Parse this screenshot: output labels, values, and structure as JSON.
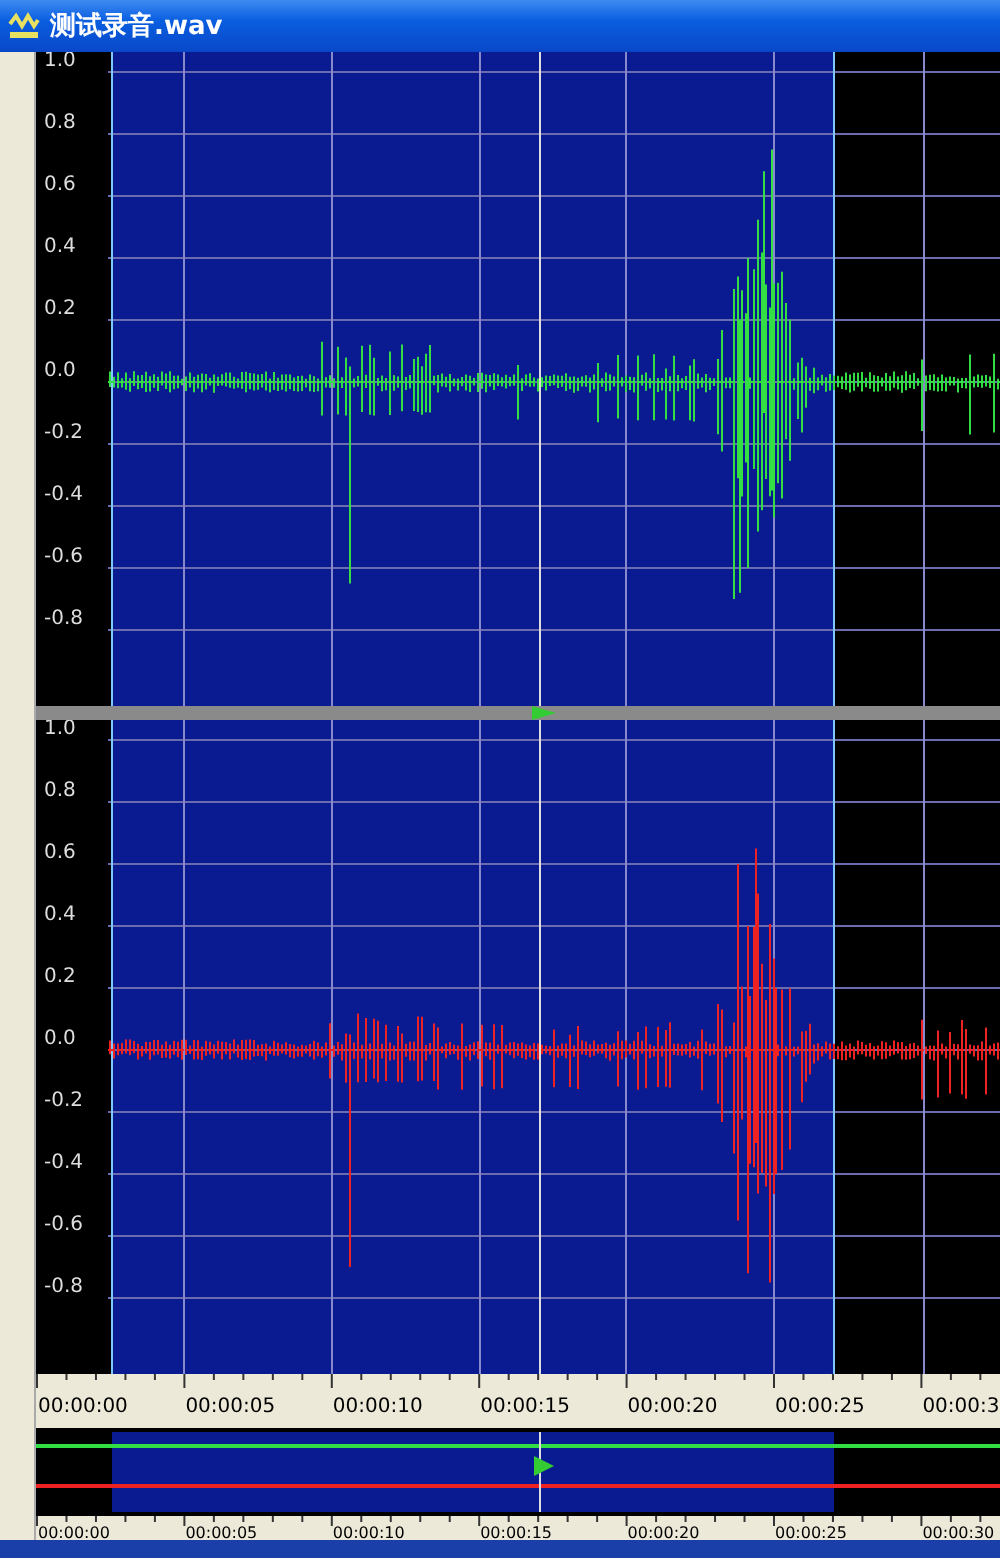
{
  "window": {
    "title": "测试录音.wav"
  },
  "channels": [
    {
      "color": "#33dd44",
      "axis_labels": [
        "1.0",
        "0.8",
        "0.6",
        "0.4",
        "0.2",
        "0.0",
        "-0.2",
        "-0.4",
        "-0.6",
        "-0.8"
      ]
    },
    {
      "color": "#ee2222",
      "axis_labels": [
        "1.0",
        "0.8",
        "0.6",
        "0.4",
        "0.2",
        "0.0",
        "-0.2",
        "-0.4",
        "-0.6",
        "-0.8"
      ]
    }
  ],
  "timeline": {
    "labels": [
      "00:00:00",
      "00:00:05",
      "00:00:10",
      "00:00:15",
      "00:00:20",
      "00:00:25",
      "00:00:3"
    ]
  },
  "overview": {
    "labels": [
      "00:00:00",
      "00:00:05",
      "00:00:10",
      "00:00:15",
      "00:00:20",
      "00:00:25",
      "00:00:30"
    ]
  }
}
